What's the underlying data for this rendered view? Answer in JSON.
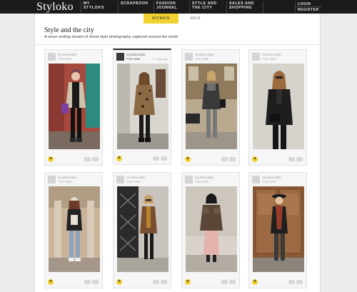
{
  "brand": {
    "name": "Styloko",
    "accent": "#f2d230",
    "nav_bg": "#1b1b1b"
  },
  "nav": {
    "items": [
      {
        "line1": "MY",
        "line2": "STYLOKO"
      },
      {
        "line1": "SCRAPBOOK",
        "line2": ""
      },
      {
        "line1": "FASHION",
        "line2": "JOURNAL"
      },
      {
        "line1": "STYLE AND",
        "line2": "THE CITY"
      },
      {
        "line1": "SALES AND",
        "line2": "SHOPPING"
      }
    ],
    "login": "LOGIN",
    "register": "REGISTER"
  },
  "tabs": {
    "women": "WOMEN",
    "men": "MEN"
  },
  "page": {
    "title": "Style and the city",
    "subtitle": "A never ending stream of street style photography captured around the world"
  },
  "cards": [
    {
      "user": "my.street.style",
      "from": "From Web",
      "time": "",
      "photo": "woman-denim-jacket-purple-bag"
    },
    {
      "user": "my.street.style",
      "from": "From Web",
      "time": "27 days ago",
      "photo": "woman-leopard-coat"
    },
    {
      "user": "my.street.style",
      "from": "From Web",
      "time": "",
      "photo": "woman-grey-coat-city-street"
    },
    {
      "user": "my.street.style",
      "from": "From Web",
      "time": "",
      "photo": "woman-black-leather-jacket"
    },
    {
      "user": "my.street.style",
      "from": "From Web",
      "time": "",
      "photo": "woman-beanie-stone-column"
    },
    {
      "user": "my.street.style",
      "from": "From Web",
      "time": "",
      "photo": "woman-sunglasses-iron-gate"
    },
    {
      "user": "my.street.style",
      "from": "From Web",
      "time": "",
      "photo": "woman-fur-jacket-pink-skirt"
    },
    {
      "user": "my.street.style",
      "from": "From Web",
      "time": "",
      "photo": "woman-hat-wooden-door"
    }
  ]
}
